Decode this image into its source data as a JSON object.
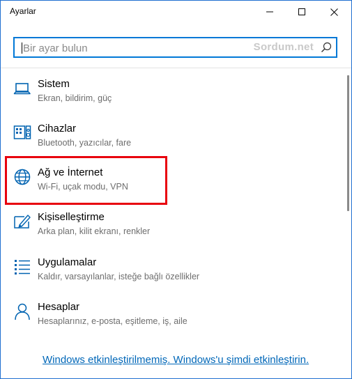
{
  "window": {
    "title": "Ayarlar"
  },
  "search": {
    "placeholder": "Bir ayar bulun",
    "value": "",
    "watermark": "Sordum.net"
  },
  "categories": [
    {
      "name": "Sistem",
      "description": "Ekran, bildirim, güç",
      "icon": "laptop-icon"
    },
    {
      "name": "Cihazlar",
      "description": "Bluetooth, yazıcılar, fare",
      "icon": "devices-icon"
    },
    {
      "name": "Ağ ve İnternet",
      "description": "Wi-Fi, uçak modu, VPN",
      "icon": "globe-icon"
    },
    {
      "name": "Kişiselleştirme",
      "description": "Arka plan, kilit ekranı, renkler",
      "icon": "personalization-icon"
    },
    {
      "name": "Uygulamalar",
      "description": "Kaldır, varsayılanlar, isteğe bağlı özellikler",
      "icon": "apps-list-icon"
    },
    {
      "name": "Hesaplar",
      "description": "Hesaplarınız, e-posta, eşitleme, iş, aile",
      "icon": "person-icon"
    }
  ],
  "activation_link": "Windows etkinleştirilmemiş. Windows'u şimdi etkinleştirin.",
  "colors": {
    "accent": "#0078d7",
    "link": "#0067b8",
    "highlight_box": "#e8000d",
    "secondary_text": "#6d6d6d"
  }
}
